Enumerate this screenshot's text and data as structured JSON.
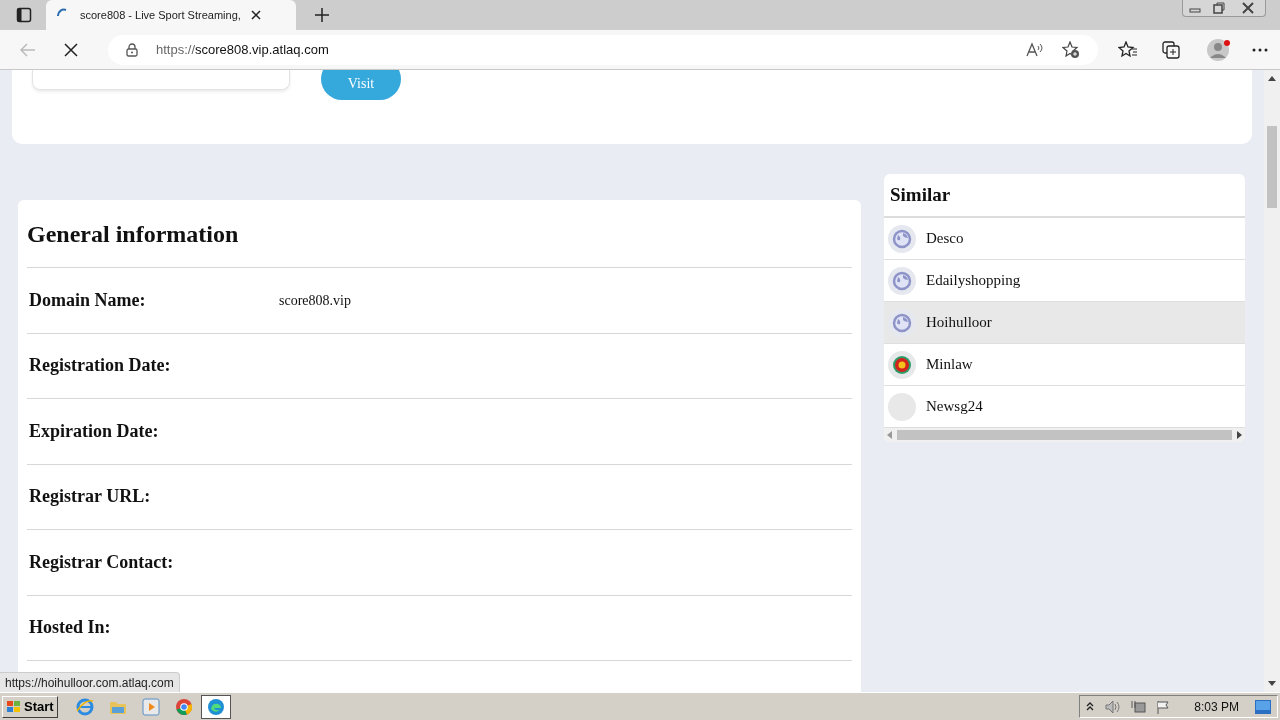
{
  "browser": {
    "tab_title": "score808 - Live Sport Streaming, ",
    "url_scheme": "https://",
    "url_host": "score808.vip.atlaq.com"
  },
  "top_card": {
    "visit_button": "Visit"
  },
  "general_information": {
    "title": "General information",
    "rows": [
      {
        "label": "Domain Name:",
        "value": "score808.vip"
      },
      {
        "label": "Registration Date:"
      },
      {
        "label": "Expiration Date:"
      },
      {
        "label": "Registrar URL:"
      },
      {
        "label": "Registrar Contact:"
      },
      {
        "label": "Hosted In:"
      }
    ]
  },
  "similar": {
    "title": "Similar",
    "items": [
      {
        "name": "Desco",
        "kind": "globe",
        "hovered": false
      },
      {
        "name": "Edailyshopping",
        "kind": "globe",
        "hovered": false
      },
      {
        "name": "Hoihulloor",
        "kind": "globe",
        "hovered": true
      },
      {
        "name": "Minlaw",
        "kind": "logo",
        "hovered": false
      },
      {
        "name": "Newsg24",
        "kind": "blank",
        "hovered": false
      }
    ]
  },
  "status_url": "https://hoihulloor.com.atlaq.com",
  "taskbar": {
    "start": "Start",
    "clock": "8:03 PM"
  }
}
